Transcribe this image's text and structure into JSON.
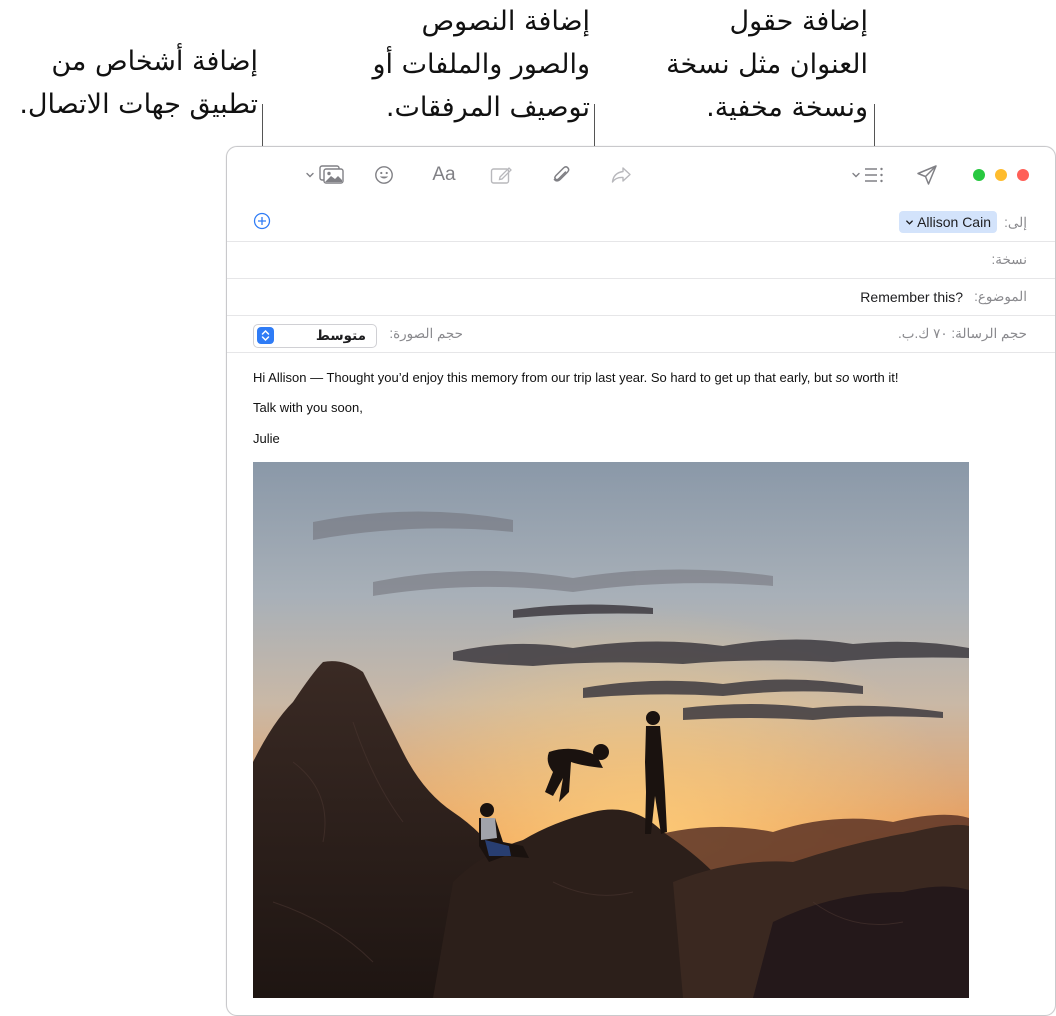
{
  "callouts": {
    "contacts": [
      "إضافة أشخاص من",
      "تطبيق جهات الاتصال."
    ],
    "content": [
      "إضافة النصوص",
      "والصور والملفات أو",
      "توصيف المرفقات."
    ],
    "fields": [
      "إضافة حقول",
      "العنوان مثل نسخة",
      "ونسخة مخفية."
    ]
  },
  "toolbar": {
    "icons": [
      "traffic-lights",
      "send-icon",
      "header-fields-icon",
      "reply-arrow-icon",
      "attachment-icon",
      "markup-icon",
      "format-icon",
      "emoji-icon",
      "photo-browser-icon"
    ],
    "format_label": "Aa"
  },
  "header": {
    "to_label": "إلى:",
    "to_recipient": "Allison Cain",
    "cc_label": "نسخة:",
    "subject_label": "الموضوع:",
    "subject_value": "Remember this?",
    "message_size_label": "حجم الرسالة:",
    "message_size_value": "٧٠ ك.ب.",
    "image_size_label": "حجم الصورة:",
    "image_size_value": "متوسط"
  },
  "message": {
    "line1_before": "Hi Allison — Thought you’d enjoy this memory from our trip last year. So hard to get up that early, but ",
    "line1_em": "so",
    "line1_after": " worth it!",
    "line2": "Talk with you soon,",
    "line3": "Julie"
  },
  "colors": {
    "accent": "#2f7cf6",
    "token_bg": "#d3e3fb",
    "close": "#ff5f57",
    "minimize": "#febc2e",
    "zoom": "#28c840"
  }
}
